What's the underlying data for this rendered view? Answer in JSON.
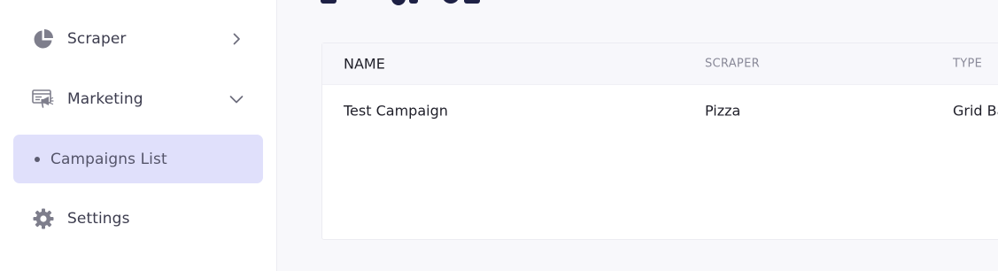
{
  "sidebar": {
    "items": [
      {
        "label": "Scraper",
        "icon": "pie-chart-icon",
        "chevron": "chevron-right-icon"
      },
      {
        "label": "Marketing",
        "icon": "billboard-icon",
        "chevron": "chevron-down-icon"
      },
      {
        "label": "Campaigns List",
        "active": true
      },
      {
        "label": "Settings",
        "icon": "gear-icon"
      }
    ]
  },
  "table": {
    "columns": [
      "NAME",
      "SCRAPER",
      "TYPE"
    ],
    "rows": [
      {
        "name": "Test Campaign",
        "scraper": "Pizza",
        "type": "Grid Ba"
      }
    ]
  },
  "colors": {
    "active_bg": "#e0e0fb",
    "icon": "#7e7e8c",
    "title": "#1e2145"
  }
}
